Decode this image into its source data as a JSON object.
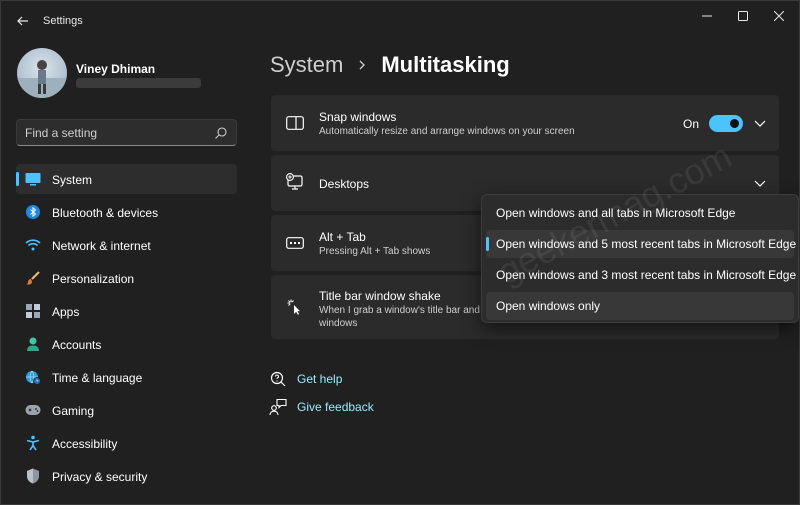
{
  "window": {
    "title": "Settings"
  },
  "profile": {
    "name": "Viney Dhiman"
  },
  "search": {
    "placeholder": "Find a setting"
  },
  "sidebar": {
    "items": [
      {
        "label": "System",
        "icon": "monitor-icon",
        "active": true
      },
      {
        "label": "Bluetooth & devices",
        "icon": "bluetooth-icon"
      },
      {
        "label": "Network & internet",
        "icon": "wifi-icon"
      },
      {
        "label": "Personalization",
        "icon": "brush-icon"
      },
      {
        "label": "Apps",
        "icon": "apps-icon"
      },
      {
        "label": "Accounts",
        "icon": "person-icon"
      },
      {
        "label": "Time & language",
        "icon": "globe-clock-icon"
      },
      {
        "label": "Gaming",
        "icon": "gamepad-icon"
      },
      {
        "label": "Accessibility",
        "icon": "accessibility-icon"
      },
      {
        "label": "Privacy & security",
        "icon": "shield-icon"
      }
    ]
  },
  "breadcrumb": {
    "parent": "System",
    "current": "Multitasking"
  },
  "cards": {
    "snap": {
      "title": "Snap windows",
      "desc": "Automatically resize and arrange windows on your screen",
      "toggle_label": "On",
      "toggle_on": true
    },
    "desktops": {
      "title": "Desktops"
    },
    "alttab": {
      "title": "Alt + Tab",
      "desc": "Pressing Alt + Tab shows"
    },
    "shake": {
      "title": "Title bar window shake",
      "desc_line1": "When I grab a window's title bar and",
      "desc_line2": "windows"
    }
  },
  "links": {
    "help": "Get help",
    "feedback": "Give feedback"
  },
  "dropdown": {
    "options": [
      "Open windows and all tabs in Microsoft Edge",
      "Open windows and 5 most recent tabs in Microsoft Edge",
      "Open windows and 3 most recent tabs in Microsoft Edge",
      "Open windows only"
    ],
    "selected_index": 1
  },
  "watermark": "geekermag.com",
  "colors": {
    "accent": "#4cc2ff",
    "background": "#202020",
    "card": "#2b2b2b",
    "link": "#99ebff"
  }
}
